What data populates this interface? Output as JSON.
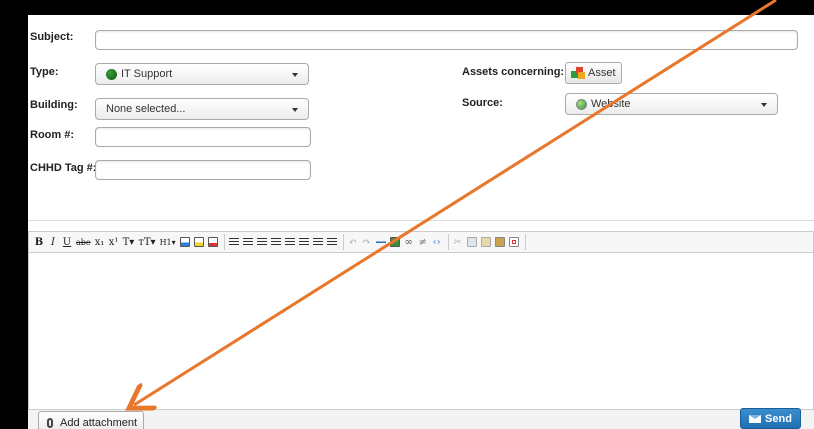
{
  "form": {
    "subject_label": "Subject:",
    "subject_value": "",
    "type_label": "Type:",
    "type_value": "IT Support",
    "building_label": "Building:",
    "building_value": "None selected...",
    "room_label": "Room #:",
    "room_value": "",
    "tag_label": "CHHD Tag #:",
    "tag_value": "",
    "assets_label": "Assets concerning:",
    "asset_button": "Asset",
    "source_label": "Source:",
    "source_value": "Website"
  },
  "toolbar": {
    "bold": "B",
    "italic": "I",
    "underline": "U",
    "strike": "abe",
    "subscript": "x₁",
    "superscript": "x¹",
    "font_size": "T▾",
    "font_family": "тT▾",
    "heading": "H1▾"
  },
  "footer": {
    "attach_label": "Add attachment",
    "send_label": "Send"
  },
  "colors": {
    "accent_send": "#1f6fb2",
    "annotation_arrow": "#e8762b",
    "type_dot": "#0b5e0b"
  }
}
